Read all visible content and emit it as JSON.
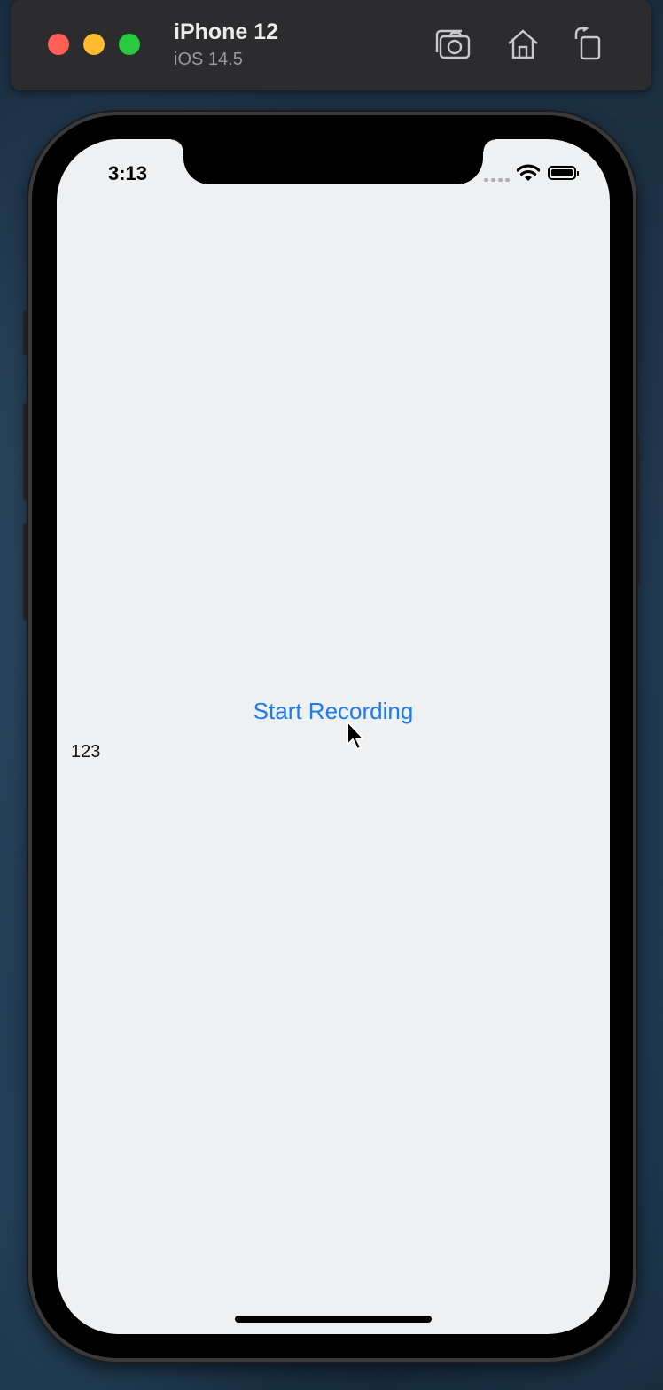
{
  "simulator": {
    "device_name": "iPhone 12",
    "os_version": "iOS 14.5",
    "icons": [
      "screenshot-icon",
      "home-icon",
      "rotate-icon"
    ]
  },
  "status_bar": {
    "time": "3:13"
  },
  "app": {
    "button_label": "Start Recording",
    "label_text": "123",
    "accent_color": "#1a7cf2",
    "background_color": "#eff0f2"
  }
}
